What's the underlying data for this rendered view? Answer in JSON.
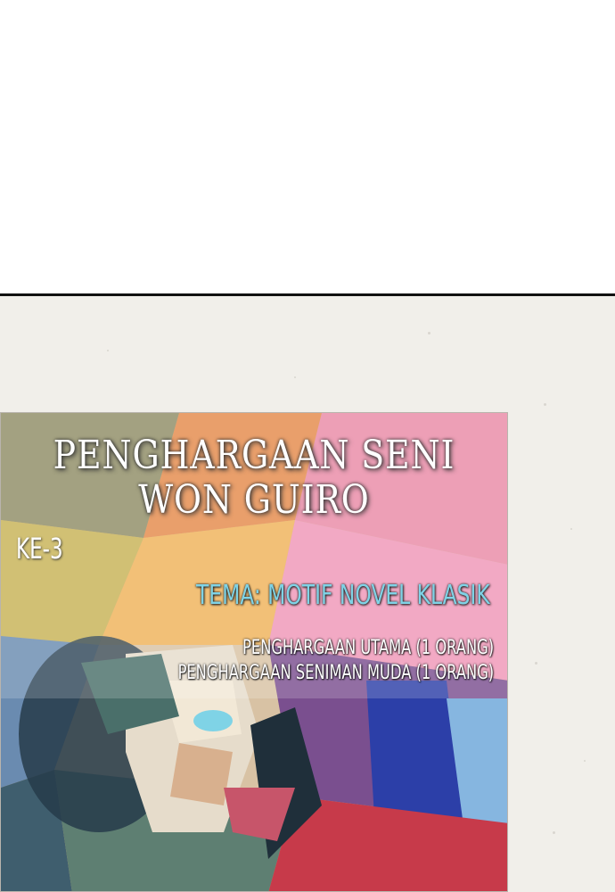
{
  "poster": {
    "title_line1": "PENGHARGAAN SENI",
    "title_line2": "WON GUIRO",
    "edition": "KE-3",
    "theme": "TEMA: MOTIF NOVEL KLASIK",
    "awards": [
      "PENGHARGAAN UTAMA (1 ORANG)",
      "PENGHARGAAN SENIMAN MUDA (1 ORANG)"
    ]
  },
  "colors": {
    "panel_bg": "#f1efea",
    "border": "#111111",
    "theme_text": "#7fd3e6"
  }
}
